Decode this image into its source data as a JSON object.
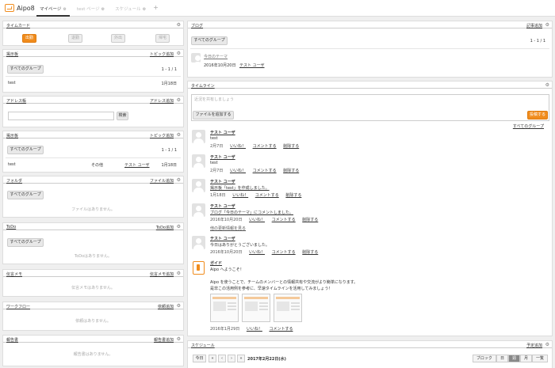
{
  "header": {
    "logo_text": "Aipo8",
    "tabs": [
      {
        "label": "マイページ",
        "active": true
      },
      {
        "label": "test ページ",
        "active": false
      },
      {
        "label": "スケジュール",
        "active": false
      }
    ],
    "add_tab_label": "+"
  },
  "timecard": {
    "title": "タイムカード",
    "buttons": [
      "出勤",
      "退勤",
      "外出",
      "帰宅"
    ]
  },
  "bbs1": {
    "title": "掲示板",
    "action": "トピック追加",
    "group": "すべてのグループ",
    "paging": "1 - 1 / 1",
    "rows": [
      {
        "title": "test",
        "date": "1月18日"
      }
    ]
  },
  "addressbook": {
    "title": "アドレス帳",
    "action": "アドレス追加",
    "search_button": "検索"
  },
  "bbs2": {
    "title": "掲示板",
    "action": "トピック追加",
    "group": "すべてのグループ",
    "paging": "1 - 1 / 1",
    "rows": [
      {
        "title": "test",
        "count": "その他",
        "user": "テスト ユーザ",
        "date": "1月18日"
      }
    ]
  },
  "folder": {
    "title": "フォルダ",
    "action": "ファイル追加",
    "group": "すべてのグループ",
    "empty": "ファイルはありません。"
  },
  "todo": {
    "title": "ToDo",
    "action": "ToDo追加",
    "group": "すべてのグループ",
    "empty": "ToDoはありません。"
  },
  "memo": {
    "title": "伝言メモ",
    "action": "伝言メモ追加",
    "empty": "伝言メモはありません。"
  },
  "workflow": {
    "title": "ワークフロー",
    "action": "依頼追加",
    "empty": "依頼はありません。"
  },
  "report": {
    "title": "報告書",
    "action": "報告書追加",
    "empty": "報告書はありません。"
  },
  "blog": {
    "title": "ブログ",
    "action": "記事追加",
    "group": "すべてのグループ",
    "paging": "1 - 1 / 1",
    "entry_title": "今日のテーマ",
    "entry_date": "2016年10月20日",
    "entry_user": "テスト ユーザ"
  },
  "timeline": {
    "title": "タイムライン",
    "input_placeholder": "近況を共有しましょう",
    "attach_button": "ファイルを追加する",
    "post_button": "投稿する",
    "group_link": "すべてのグループ",
    "like": "いいね！",
    "comment": "コメントする",
    "delete": "削除する",
    "more_link": "他の更新情報を見る",
    "items": [
      {
        "user": "テスト ユーザ",
        "body": "test",
        "date": "2月7日"
      },
      {
        "user": "テスト ユーザ",
        "body": "test",
        "date": "2月7日"
      },
      {
        "user": "テスト ユーザ",
        "body": "掲示板「test」を作成しました。",
        "date": "1月18日"
      },
      {
        "user": "テスト ユーザ",
        "body": "ブログ「今日のテーマ」にコメントしました。",
        "date": "2016年10月20日"
      },
      {
        "user": "テスト ユーザ",
        "body": "今日はありがとうございました。",
        "date": "2016年10月20日"
      }
    ],
    "guide": {
      "user": "ガイド",
      "line1": "Aipo へようこそ！",
      "line2": "Aipo を使うことで、チームのメンバーとの情報共有や交流がより簡単になります。",
      "line3": "是非この活用例を参考に、早速タイムラインを活用してみましょう！",
      "date": "2016年1月29日"
    }
  },
  "schedule": {
    "title": "スケジュール",
    "action": "予定追加",
    "today_button": "今日",
    "date_label": "2017年2月22日(水)",
    "views": [
      "ブロック",
      "日",
      "週",
      "月",
      "一覧"
    ],
    "active_view": "週"
  }
}
